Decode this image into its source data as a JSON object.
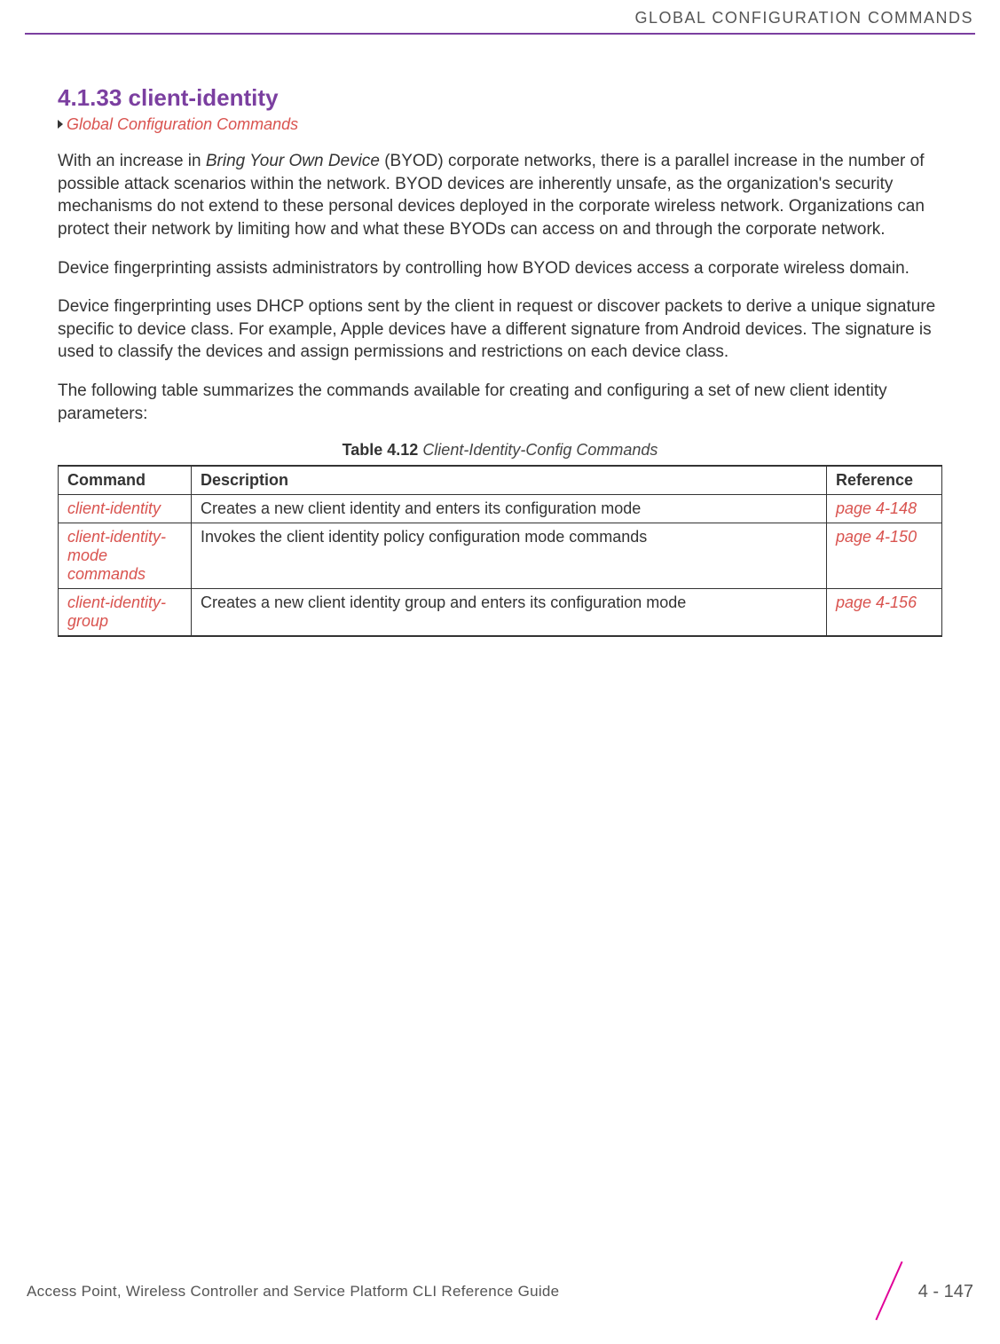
{
  "header": {
    "title": "GLOBAL CONFIGURATION COMMANDS"
  },
  "section": {
    "number_title": "4.1.33 client-identity",
    "breadcrumb": "Global Configuration Commands",
    "p1_before_em": "With an increase in ",
    "p1_em": "Bring Your Own Device",
    "p1_after_em": " (BYOD) corporate networks, there is a parallel increase in the number of possible attack scenarios within the network. BYOD devices are inherently unsafe, as the organization's security mechanisms do not extend to these personal devices deployed in the corporate wireless network. Organizations can protect their network by limiting how and what these BYODs can access on and through the corporate network.",
    "p2": "Device fingerprinting assists administrators by controlling how BYOD devices access a corporate wireless domain.",
    "p3": "Device fingerprinting uses DHCP options sent by the client in request or discover packets to derive a unique signature specific to device class. For example, Apple devices have a different signature from Android devices. The signature is used to classify the devices and assign permissions and restrictions on each device class.",
    "p4": "The following table summarizes the commands available for creating and configuring a set of new client identity parameters:"
  },
  "table": {
    "caption_bold": "Table 4.12",
    "caption_ital": "Client-Identity-Config Commands",
    "headers": {
      "command": "Command",
      "description": "Description",
      "reference": "Reference"
    },
    "rows": [
      {
        "command": "client-identity",
        "description": "Creates a new client identity and enters its configuration mode",
        "reference": "page 4-148"
      },
      {
        "command": "client-identity-mode commands",
        "description": "Invokes the client identity policy configuration mode commands",
        "reference": "page 4-150"
      },
      {
        "command": "client-identity-group",
        "description": "Creates a new client identity group and enters its configuration mode",
        "reference": "page 4-156"
      }
    ]
  },
  "footer": {
    "text": "Access Point, Wireless Controller and Service Platform CLI Reference Guide",
    "page": "4 - 147"
  }
}
